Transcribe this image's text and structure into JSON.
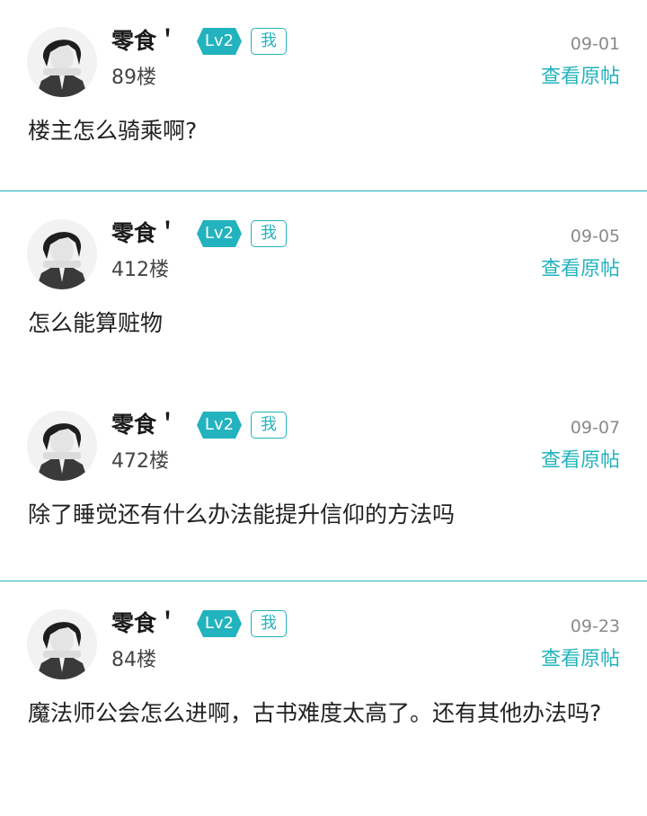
{
  "posts": [
    {
      "username": "零食＇",
      "level": "Lv2",
      "me_badge": "我",
      "floor": "89楼",
      "date": "09-01",
      "view_label": "查看原帖",
      "content": "楼主怎么骑乘啊?"
    },
    {
      "username": "零食＇",
      "level": "Lv2",
      "me_badge": "我",
      "floor": "412楼",
      "date": "09-05",
      "view_label": "查看原帖",
      "content": "怎么能算赃物"
    },
    {
      "username": "零食＇",
      "level": "Lv2",
      "me_badge": "我",
      "floor": "472楼",
      "date": "09-07",
      "view_label": "查看原帖",
      "content": "除了睡觉还有什么办法能提升信仰的方法吗"
    },
    {
      "username": "零食＇",
      "level": "Lv2",
      "me_badge": "我",
      "floor": "84楼",
      "date": "09-23",
      "view_label": "查看原帖",
      "content": "魔法师公会怎么进啊，古书难度太高了。还有其他办法吗?"
    }
  ],
  "colors": {
    "accent": "#23b3be",
    "text": "#222222",
    "muted": "#8a8a8a",
    "background": "#ffffff"
  }
}
